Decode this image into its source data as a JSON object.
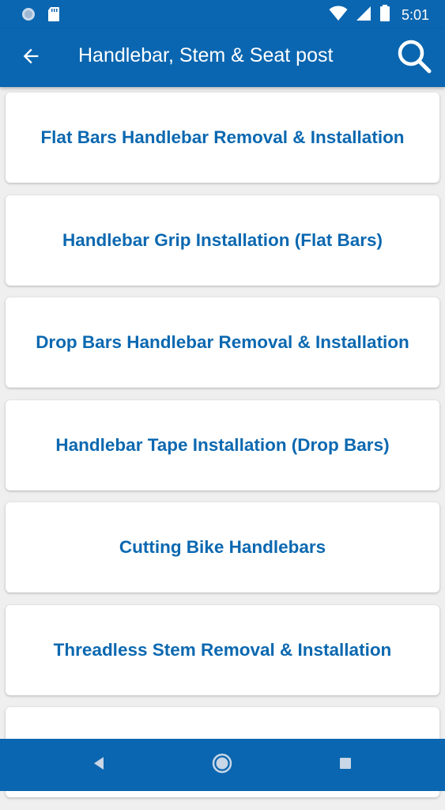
{
  "status_bar": {
    "time": "5:01",
    "icons": [
      "circle-notification-icon",
      "sd-card-icon",
      "wifi-icon",
      "signal-icon",
      "battery-icon"
    ]
  },
  "app_bar": {
    "title": "Handlebar, Stem & Seat post",
    "back_icon": "arrow-back-icon",
    "search_icon": "search-icon"
  },
  "list": {
    "items": [
      {
        "label": "Flat Bars Handlebar Removal & Installation"
      },
      {
        "label": "Handlebar Grip Installation (Flat Bars)"
      },
      {
        "label": "Drop Bars Handlebar Removal & Installation"
      },
      {
        "label": "Handlebar Tape Installation (Drop Bars)"
      },
      {
        "label": "Cutting Bike Handlebars"
      },
      {
        "label": "Threadless Stem Removal & Installation"
      },
      {
        "label": ""
      }
    ]
  },
  "nav_bar": {
    "icons": [
      "nav-back-icon",
      "nav-home-icon",
      "nav-recents-icon"
    ]
  },
  "colors": {
    "primary": "#0a66b0",
    "card_text": "#0b68b0",
    "background": "#efefef"
  }
}
